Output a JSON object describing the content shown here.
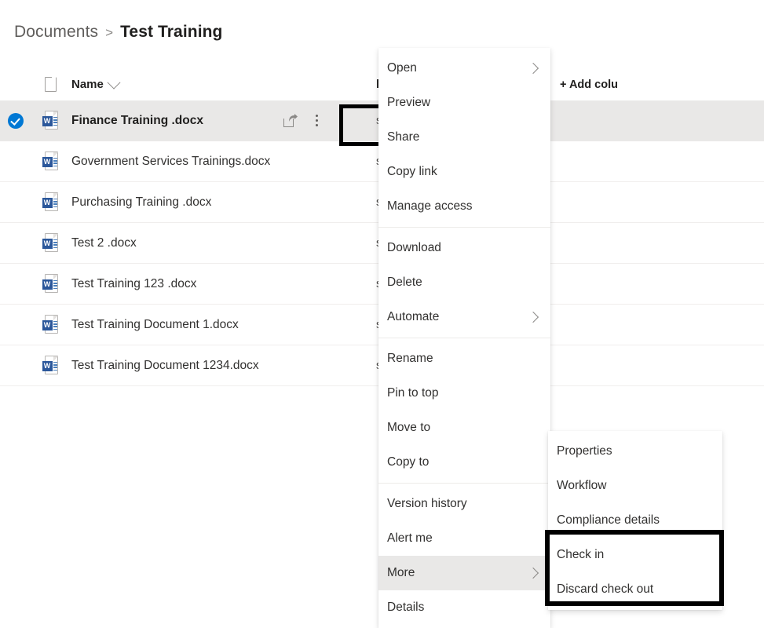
{
  "breadcrumb": {
    "root": "Documents",
    "separator": ">",
    "current": "Test Training"
  },
  "table": {
    "columns": {
      "file_type_icon": "document-icon",
      "name": "Name",
      "modified_by": "lodified By",
      "add_column": "+ Add colu"
    },
    "rows": [
      {
        "name": "Finance Training .docx",
        "modified_by": "sheton Richardson",
        "selected": true,
        "file_icon": "word-icon"
      },
      {
        "name": "Government Services Trainings.docx",
        "modified_by": "sheton Richardson",
        "selected": false,
        "file_icon": "word-icon"
      },
      {
        "name": "Purchasing Training .docx",
        "modified_by": "sheton Richardson",
        "selected": false,
        "file_icon": "word-icon"
      },
      {
        "name": "Test 2 .docx",
        "modified_by": "sheton Richardson",
        "selected": false,
        "file_icon": "word-icon"
      },
      {
        "name": "Test Training 123 .docx",
        "modified_by": "sheton Richardson",
        "selected": false,
        "file_icon": "word-icon"
      },
      {
        "name": "Test Training Document 1.docx",
        "modified_by": "sheton Richardson",
        "selected": false,
        "file_icon": "word-icon"
      },
      {
        "name": "Test Training Document 1234.docx",
        "modified_by": "sheton Richardson",
        "selected": false,
        "file_icon": "word-icon"
      }
    ]
  },
  "context_menu": {
    "items": [
      {
        "label": "Open",
        "submenu": true
      },
      {
        "label": "Preview",
        "submenu": false
      },
      {
        "label": "Share",
        "submenu": false
      },
      {
        "label": "Copy link",
        "submenu": false
      },
      {
        "label": "Manage access",
        "submenu": false
      },
      {
        "label": "Download",
        "submenu": false
      },
      {
        "label": "Delete",
        "submenu": false
      },
      {
        "label": "Automate",
        "submenu": true
      },
      {
        "label": "Rename",
        "submenu": false
      },
      {
        "label": "Pin to top",
        "submenu": false
      },
      {
        "label": "Move to",
        "submenu": false
      },
      {
        "label": "Copy to",
        "submenu": false
      },
      {
        "label": "Version history",
        "submenu": false
      },
      {
        "label": "Alert me",
        "submenu": false
      },
      {
        "label": "More",
        "submenu": true,
        "hovered": true
      },
      {
        "label": "Details",
        "submenu": false
      }
    ]
  },
  "submenu": {
    "items": [
      {
        "label": "Properties",
        "highlighted": false
      },
      {
        "label": "Workflow",
        "highlighted": false
      },
      {
        "label": "Compliance details",
        "highlighted": false
      },
      {
        "label": "Check in",
        "highlighted": true
      },
      {
        "label": "Discard check out",
        "highlighted": true
      }
    ]
  },
  "row_actions": {
    "share_icon": "share-icon",
    "more_actions_icon": "ellipsis-vertical-icon"
  },
  "colors": {
    "accent": "#0078d4",
    "word_blue": "#2b579a",
    "selected_row": "#e9e8e7",
    "highlight_box": "#000000",
    "text_primary": "#323130",
    "text_secondary": "#605e5c"
  }
}
